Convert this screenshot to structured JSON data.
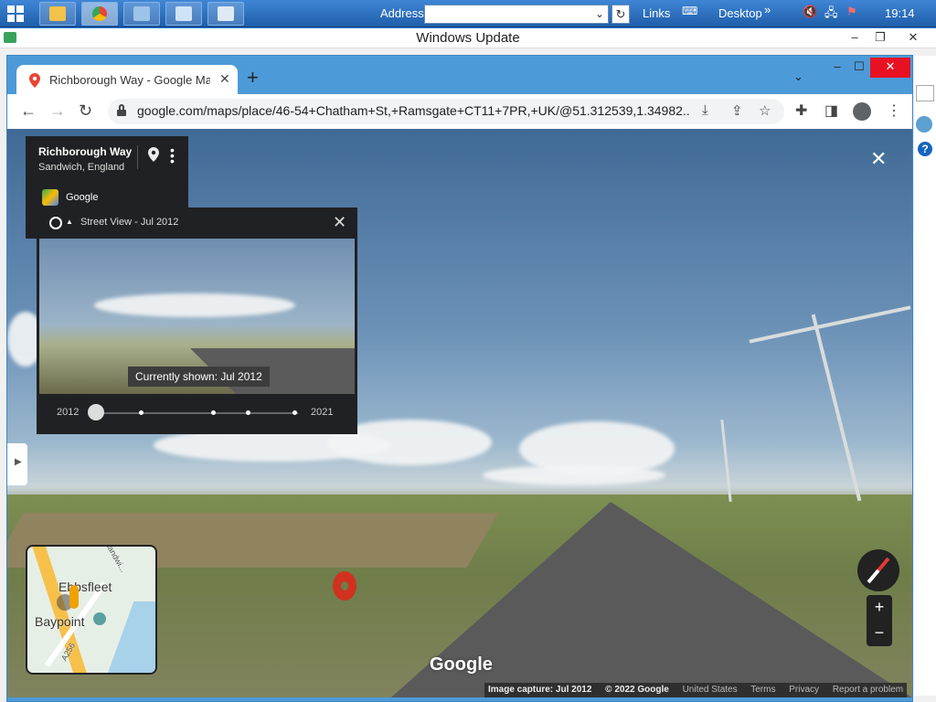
{
  "taskbar": {
    "address_label": "Address",
    "address_value": "",
    "links_label": "Links",
    "desktop_label": "Desktop",
    "overflow_label": "»",
    "clock": "19:14"
  },
  "window": {
    "title": "Windows Update",
    "minimize": "–",
    "maximize": "❐",
    "close": "✕"
  },
  "browser": {
    "tab_title": "Richborough Way - Google Maps",
    "new_tab": "+",
    "tabs_menu": "⌄",
    "minimize": "–",
    "maximize": "☐",
    "close": "✕",
    "url": "google.com/maps/place/46-54+Chatham+St,+Ramsgate+CT11+7PR,+UK/@51.312539,1.34982..."
  },
  "place": {
    "name": "Richborough Way",
    "locality": "Sandwich, England",
    "provider": "Google"
  },
  "timemachine": {
    "title": "Street View - Jul 2012",
    "tooltip": "Currently shown: Jul 2012",
    "year_start": "2012",
    "year_end": "2021"
  },
  "minimap": {
    "label_town": "Ebbsfleet",
    "label_poi": "Baypoint",
    "label_road": "A256",
    "label_road2": "Sandwi..."
  },
  "controls": {
    "zoom_in": "+",
    "zoom_out": "−",
    "close_view": "✕"
  },
  "footer": {
    "google_mark": "Google",
    "capture": "Image capture: Jul 2012",
    "copyright": "© 2022 Google",
    "region": "United States",
    "terms": "Terms",
    "privacy": "Privacy",
    "report": "Report a problem"
  }
}
